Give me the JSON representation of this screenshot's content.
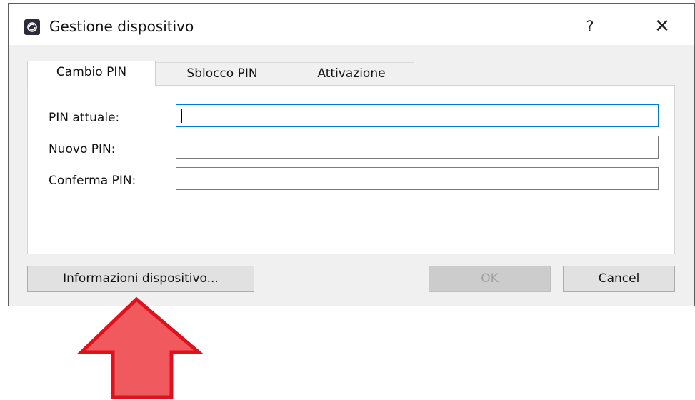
{
  "window": {
    "title": "Gestione dispositivo",
    "help_label": "?",
    "close_label": "✕"
  },
  "tabs": [
    {
      "label": "Cambio PIN",
      "active": true
    },
    {
      "label": "Sblocco PIN",
      "active": false
    },
    {
      "label": "Attivazione",
      "active": false
    }
  ],
  "form": {
    "fields": [
      {
        "label": "PIN attuale:",
        "value": ""
      },
      {
        "label": "Nuovo PIN:",
        "value": ""
      },
      {
        "label": "Conferma PIN:",
        "value": ""
      }
    ]
  },
  "buttons": {
    "info": "Informazioni dispositivo...",
    "ok": "OK",
    "cancel": "Cancel"
  },
  "colors": {
    "arrow_fill": "#f05a5e",
    "arrow_stroke": "#e0101c",
    "focus_border": "#0078d7"
  }
}
